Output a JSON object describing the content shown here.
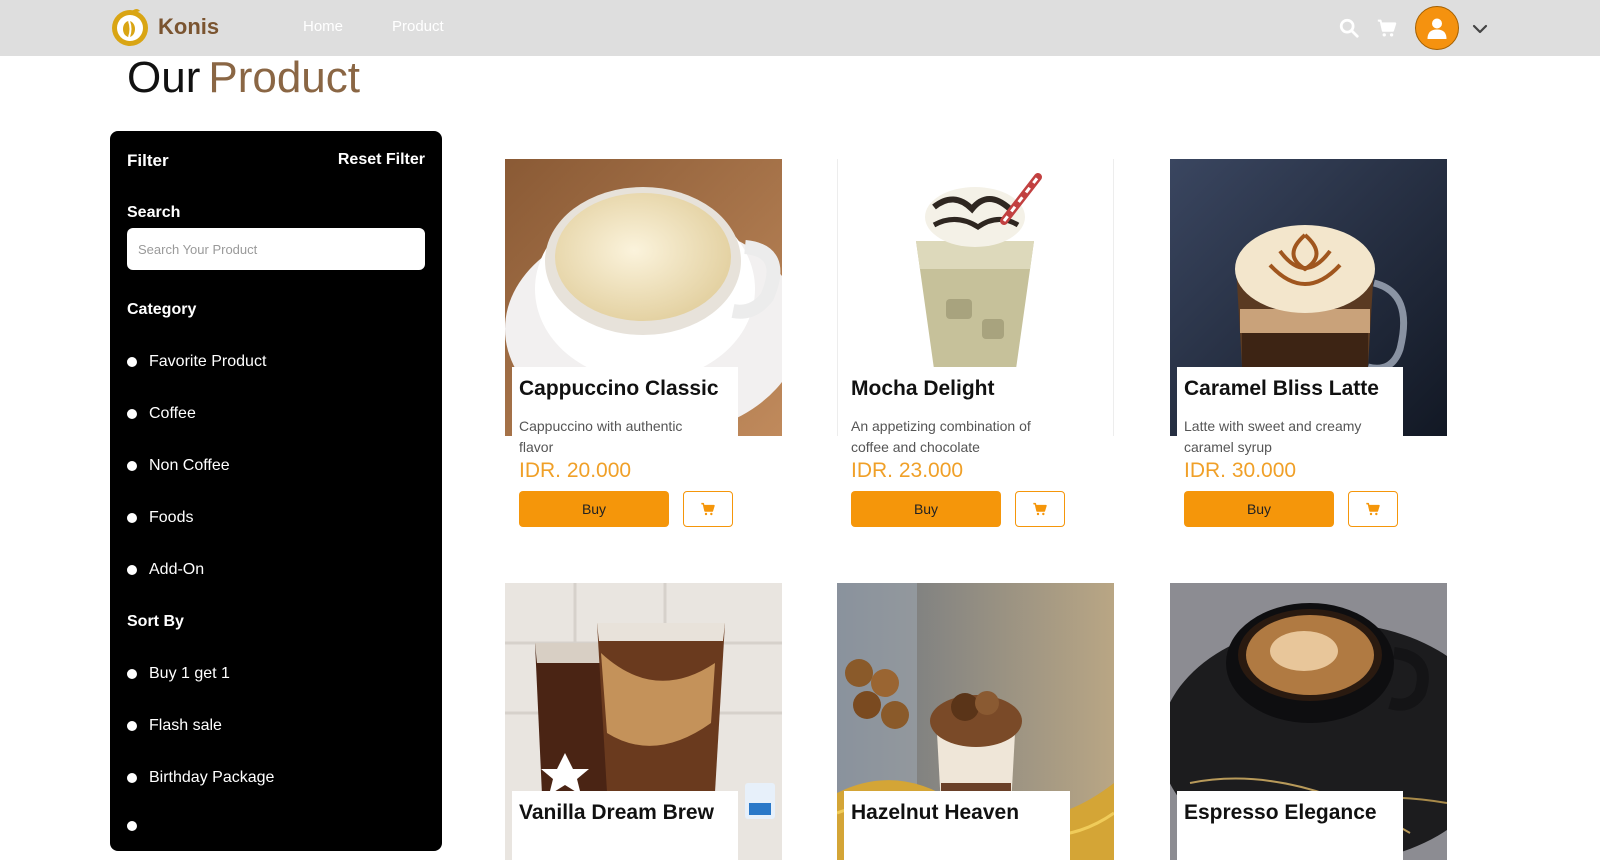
{
  "brand": {
    "name": "Konis",
    "logo_icon": "coffee-cup-logo",
    "accent": "#f5960a"
  },
  "nav": {
    "links": [
      {
        "label": "Home"
      },
      {
        "label": "Product"
      }
    ],
    "icons": [
      "search-icon",
      "cart-icon",
      "user-icon",
      "chevron-down-icon"
    ]
  },
  "page": {
    "title_part1": "Our",
    "title_part2": "Product"
  },
  "filter": {
    "title": "Filter",
    "reset_label": "Reset Filter",
    "search_label": "Search",
    "search_placeholder": "Search Your Product",
    "search_value": "",
    "category_label": "Category",
    "categories": [
      {
        "label": "Favorite Product"
      },
      {
        "label": "Coffee"
      },
      {
        "label": "Non Coffee"
      },
      {
        "label": "Foods"
      },
      {
        "label": "Add-On"
      }
    ],
    "sort_label": "Sort By",
    "sort_options": [
      {
        "label": "Buy 1 get 1"
      },
      {
        "label": "Flash sale"
      },
      {
        "label": "Birthday Package"
      }
    ]
  },
  "products": [
    {
      "name": "Cappuccino Classic",
      "description": "Cappuccino with authentic flavor",
      "price": "IDR. 20.000",
      "buy_label": "Buy",
      "image": "cappuccino-photo"
    },
    {
      "name": "Mocha Delight",
      "description": "An appetizing combination of coffee and chocolate",
      "price": "IDR. 23.000",
      "buy_label": "Buy",
      "image": "mocha-photo"
    },
    {
      "name": "Caramel Bliss Latte",
      "description": "Latte with sweet and creamy caramel syrup",
      "price": "IDR. 30.000",
      "buy_label": "Buy",
      "image": "caramel-latte-photo"
    },
    {
      "name": "Vanilla Dream Brew",
      "image": "iced-coffee-photo"
    },
    {
      "name": "Hazelnut Heaven",
      "image": "hazelnut-drink-photo"
    },
    {
      "name": "Espresso Elegance",
      "image": "espresso-photo"
    }
  ]
}
